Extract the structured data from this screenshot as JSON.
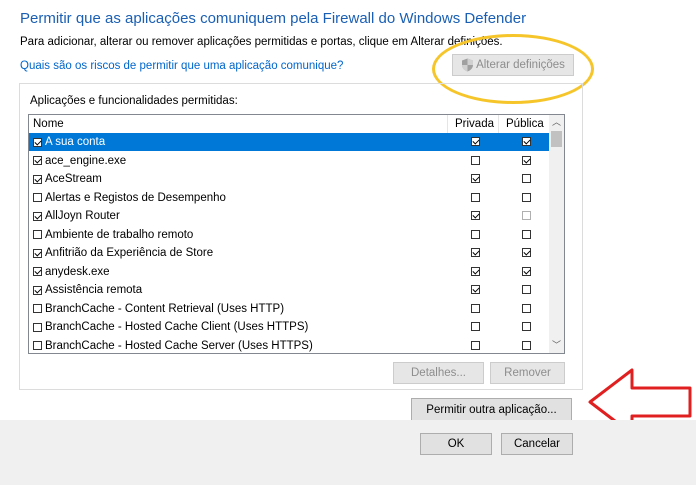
{
  "window": {
    "title": "Permitir que as aplicações comuniquem pela Firewall do Windows Defender",
    "subtitle": "Para adicionar, alterar ou remover aplicações permitidas e portas, clique em Alterar definições.",
    "risk_link": "Quais são os riscos de permitir que uma aplicação comunique?"
  },
  "buttons": {
    "alterar": "Alterar definições",
    "detalhes": "Detalhes...",
    "remover": "Remover",
    "permitir_outra": "Permitir outra aplicação...",
    "ok": "OK",
    "cancelar": "Cancelar"
  },
  "list": {
    "group_label": "Aplicações e funcionalidades permitidas:",
    "columns": {
      "name": "Nome",
      "private": "Privada",
      "public": "Pública"
    },
    "rows": [
      {
        "name": "A sua conta",
        "enabled": true,
        "private": true,
        "public": true,
        "selected": true
      },
      {
        "name": "ace_engine.exe",
        "enabled": true,
        "private": false,
        "public": true
      },
      {
        "name": "AceStream",
        "enabled": true,
        "private": true,
        "public": false
      },
      {
        "name": "Alertas e Registos de Desempenho",
        "enabled": false,
        "private": false,
        "public": false
      },
      {
        "name": "AllJoyn Router",
        "enabled": true,
        "private": true,
        "public": false,
        "public_dim": true
      },
      {
        "name": "Ambiente de trabalho remoto",
        "enabled": false,
        "private": false,
        "public": false
      },
      {
        "name": "Anfitrião da Experiência de Store",
        "enabled": true,
        "private": true,
        "public": true
      },
      {
        "name": "anydesk.exe",
        "enabled": true,
        "private": true,
        "public": true
      },
      {
        "name": "Assistência remota",
        "enabled": true,
        "private": true,
        "public": false
      },
      {
        "name": "BranchCache - Content Retrieval (Uses HTTP)",
        "enabled": false,
        "private": false,
        "public": false
      },
      {
        "name": "BranchCache - Hosted Cache Client (Uses HTTPS)",
        "enabled": false,
        "private": false,
        "public": false
      },
      {
        "name": "BranchCache - Hosted Cache Server (Uses HTTPS)",
        "enabled": false,
        "private": false,
        "public": false
      }
    ]
  },
  "icons": {
    "shield": "shield-icon",
    "scroll_up": "chevron-up-icon",
    "scroll_down": "chevron-down-icon"
  },
  "colors": {
    "title": "#1a5fb4",
    "link": "#0066cc",
    "selection": "#0078d7",
    "highlight_ellipse": "#f5c52a",
    "arrow": "#e02020"
  }
}
